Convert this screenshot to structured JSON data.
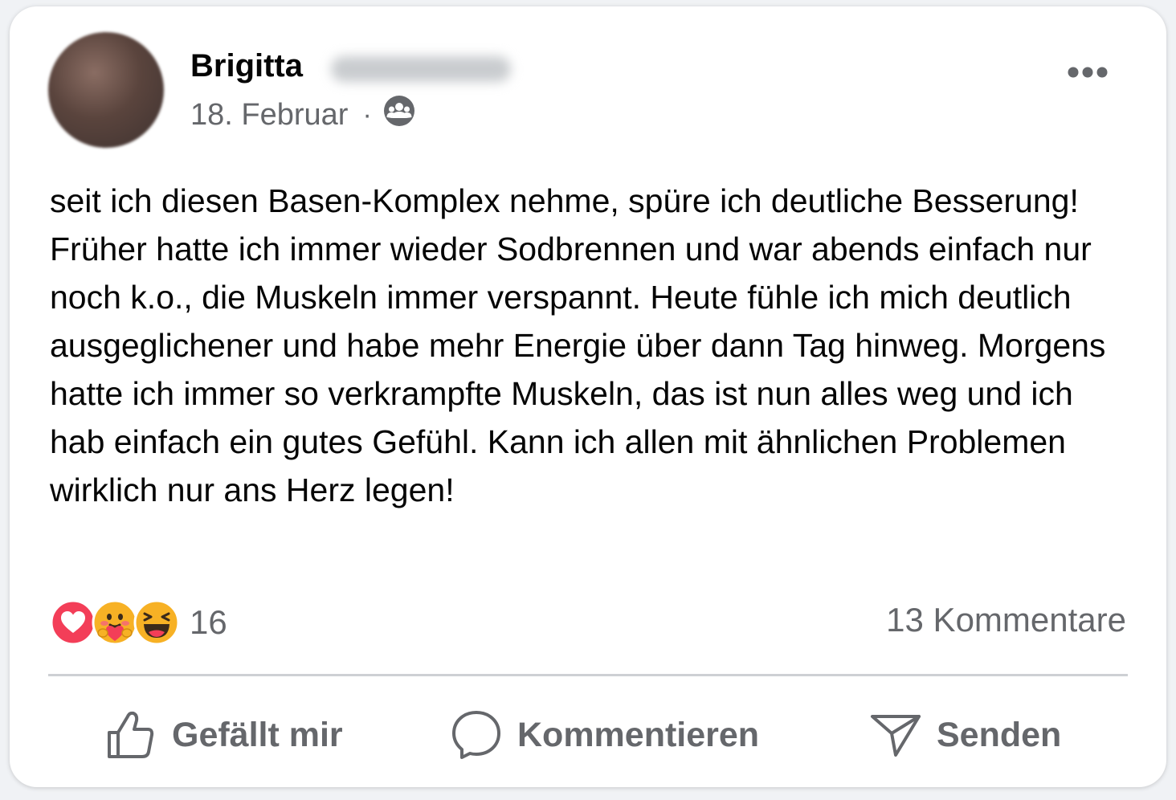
{
  "post": {
    "author_first_name": "Brigitta",
    "date": "18. Februar",
    "separator": "·",
    "audience_icon": "group-audience-icon",
    "more_icon": "more-options-icon",
    "text": "seit ich diesen Basen-Komplex nehme, spüre ich deutliche Besserung! Früher hatte ich immer wieder Sodbrennen und war abends einfach nur noch k.o., die Muskeln immer verspannt. Heute fühle ich mich deutlich ausgeglichener und habe mehr Energie über dann Tag hinweg. Morgens hatte ich immer so verkrampfte Muskeln, das ist nun alles weg und ich hab einfach ein gutes Gefühl. Kann ich allen mit ähnlichen Problemen wirklich nur ans Herz legen!"
  },
  "engagement": {
    "reaction_icons": [
      "love-reaction-icon",
      "care-reaction-icon",
      "haha-reaction-icon"
    ],
    "reaction_count": "16",
    "comment_count": "13 Kommentare"
  },
  "actions": {
    "like_label": "Gefällt mir",
    "comment_label": "Kommentieren",
    "send_label": "Senden"
  },
  "colors": {
    "text_primary": "#050505",
    "text_secondary": "#65676b",
    "love_red": "#f33e58",
    "emoji_yellow": "#f7b125",
    "divider": "#ced0d4"
  }
}
